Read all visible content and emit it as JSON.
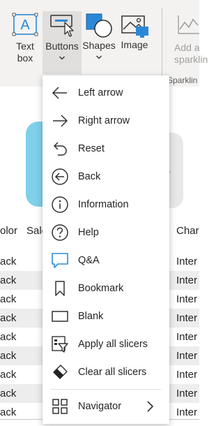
{
  "ribbon": {
    "buttons": [
      {
        "id": "textbox",
        "label_line1": "Text",
        "label_line2": "box",
        "icon": "textbox-icon"
      },
      {
        "id": "buttons",
        "label": "Buttons",
        "icon": "button-cursor-icon",
        "selected": true
      },
      {
        "id": "shapes",
        "label": "Shapes",
        "icon": "shapes-icon"
      },
      {
        "id": "image",
        "label": "Image",
        "icon": "image-icon"
      },
      {
        "id": "sparkline",
        "label_line1": "Add a",
        "label_line2": "sparklin",
        "icon": "sparkline-icon",
        "disabled": true
      }
    ],
    "group_label": "Sparklin"
  },
  "table": {
    "headers": [
      "olor",
      "Sale",
      "Char"
    ],
    "rows": [
      {
        "c1": "ack",
        "c2": "Inter"
      },
      {
        "c1": "ack",
        "c2": "Inter"
      },
      {
        "c1": "ack",
        "c2": "Inter"
      },
      {
        "c1": "ack",
        "c2": "Inter"
      },
      {
        "c1": "ack",
        "c2": "Inter"
      },
      {
        "c1": "ack",
        "c2": "Inter"
      },
      {
        "c1": "ack",
        "c2": "Inter"
      },
      {
        "c1": "ack",
        "c2": "Inter"
      },
      {
        "c1": "ack",
        "c2": "Inter"
      }
    ]
  },
  "menu": {
    "items": [
      {
        "label": "Left arrow",
        "icon": "left-arrow-icon"
      },
      {
        "label": "Right arrow",
        "icon": "right-arrow-icon"
      },
      {
        "label": "Reset",
        "icon": "reset-icon"
      },
      {
        "label": "Back",
        "icon": "back-icon"
      },
      {
        "label": "Information",
        "icon": "information-icon"
      },
      {
        "label": "Help",
        "icon": "help-icon"
      },
      {
        "label": "Q&A",
        "icon": "qna-icon"
      },
      {
        "label": "Bookmark",
        "icon": "bookmark-icon"
      },
      {
        "label": "Blank",
        "icon": "blank-icon"
      },
      {
        "label": "Apply all slicers",
        "icon": "apply-slicers-icon"
      },
      {
        "label": "Clear all slicers",
        "icon": "clear-slicers-icon"
      },
      {
        "label": "Navigator",
        "icon": "navigator-icon",
        "has_submenu": true
      }
    ]
  },
  "colors": {
    "ribbon_bg": "#f3f2f1",
    "selected_bg": "#e1dfdd",
    "accent_blue": "#2b88d8",
    "shape_fill": "#7fd0ea"
  }
}
